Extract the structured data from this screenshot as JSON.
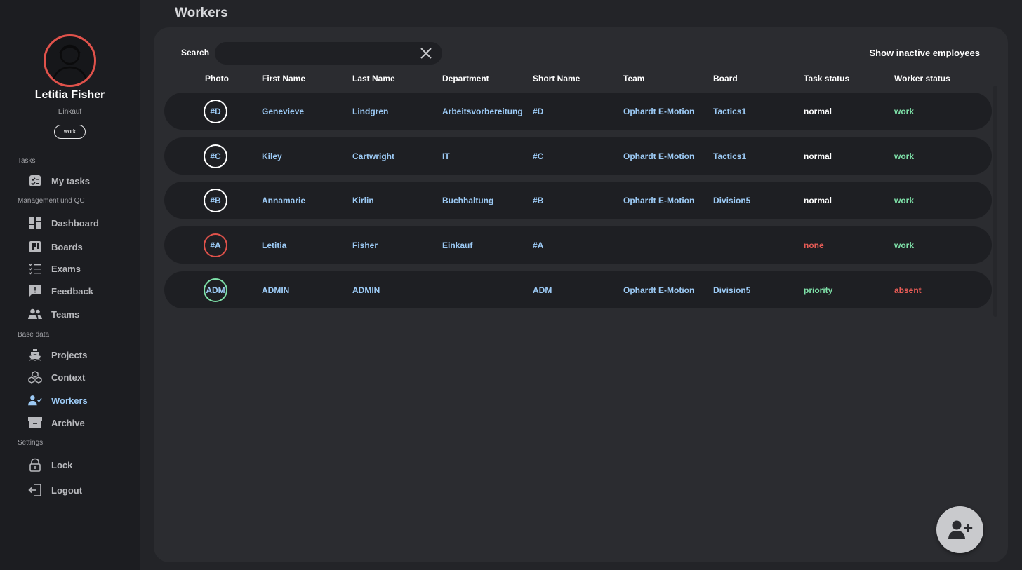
{
  "user": {
    "name": "Letitia Fisher",
    "department": "Einkauf",
    "status": "work"
  },
  "sidebar": {
    "sections": {
      "tasks": "Tasks",
      "management": "Management und QC",
      "base": "Base data",
      "settings": "Settings"
    },
    "items": {
      "my_tasks": "My tasks",
      "dashboard": "Dashboard",
      "boards": "Boards",
      "exams": "Exams",
      "feedback": "Feedback",
      "teams": "Teams",
      "projects": "Projects",
      "context": "Context",
      "workers": "Workers",
      "archive": "Archive",
      "lock": "Lock",
      "logout": "Logout"
    }
  },
  "page": {
    "title": "Workers"
  },
  "search": {
    "label": "Search",
    "value": "",
    "placeholder": ""
  },
  "toggle": {
    "show_inactive": "Show inactive employees"
  },
  "table": {
    "headers": {
      "photo": "Photo",
      "first": "First Name",
      "last": "Last Name",
      "dept": "Department",
      "short": "Short Name",
      "team": "Team",
      "board": "Board",
      "task": "Task status",
      "worker": "Worker status"
    },
    "rows": [
      {
        "badge": "#D",
        "first": "Genevieve",
        "last": "Lindgren",
        "dept": "Arbeitsvorbereitung",
        "short": "#D",
        "team": "Ophardt E-Motion",
        "board": "Tactics1",
        "task": "normal",
        "worker": "work"
      },
      {
        "badge": "#C",
        "first": "Kiley",
        "last": "Cartwright",
        "dept": "IT",
        "short": "#C",
        "team": "Ophardt E-Motion",
        "board": "Tactics1",
        "task": "normal",
        "worker": "work"
      },
      {
        "badge": "#B",
        "first": "Annamarie",
        "last": "Kirlin",
        "dept": "Buchhaltung",
        "short": "#B",
        "team": "Ophardt E-Motion",
        "board": "Division5",
        "task": "normal",
        "worker": "work"
      },
      {
        "badge": "#A",
        "first": "Letitia",
        "last": "Fisher",
        "dept": "Einkauf",
        "short": "#A",
        "team": "",
        "board": "",
        "task": "none",
        "worker": "work"
      },
      {
        "badge": "ADM",
        "first": "ADMIN",
        "last": "ADMIN",
        "dept": "",
        "short": "ADM",
        "team": "Ophardt E-Motion",
        "board": "Division5",
        "task": "priority",
        "worker": "absent"
      }
    ]
  },
  "colors": {
    "accent": "#9ccaf5",
    "danger": "#e85c56",
    "success": "#7ee0a8",
    "panel": "#2b2c30",
    "sidebar": "#1c1d21"
  },
  "icons": {
    "fab": "add-user-icon",
    "clear": "close-icon"
  }
}
